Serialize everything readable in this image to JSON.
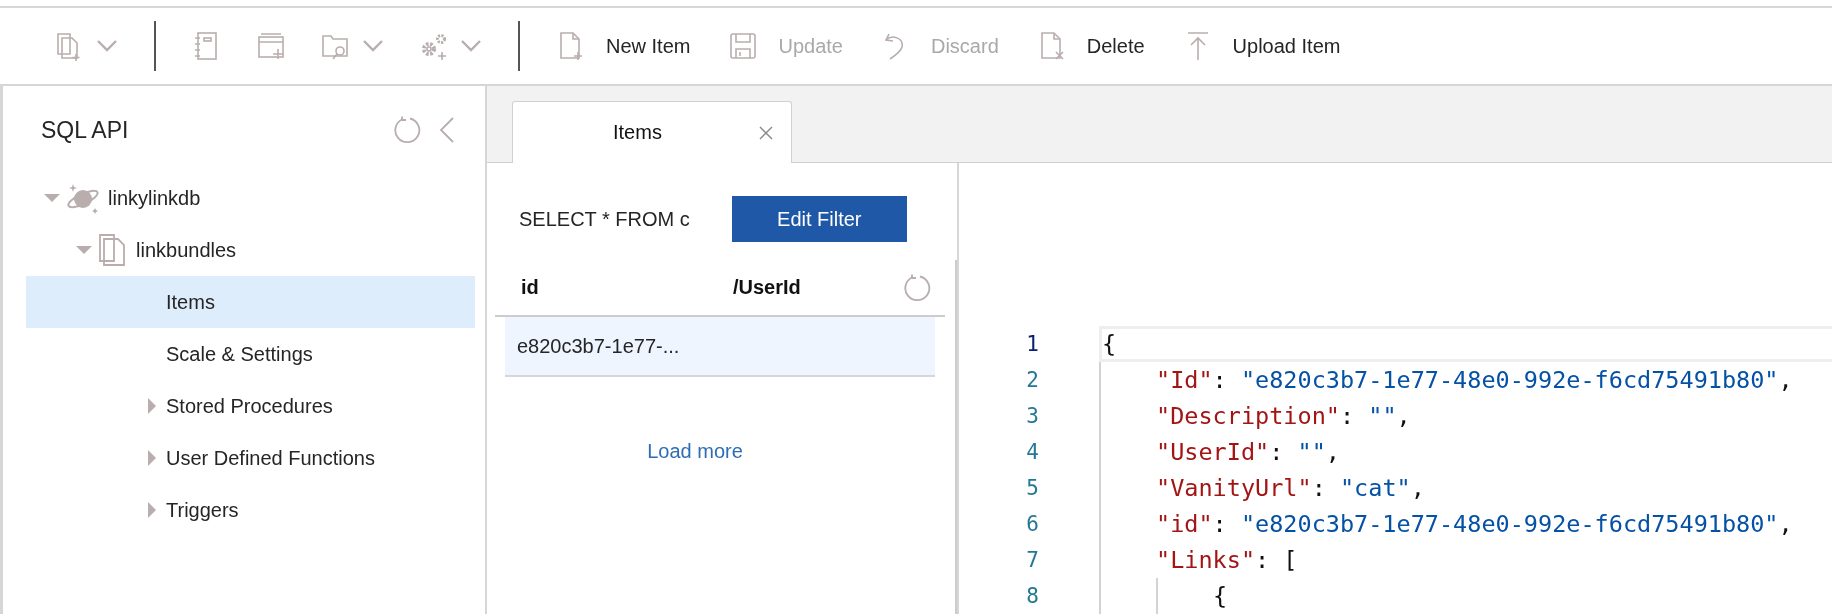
{
  "toolbar": [
    {
      "kind": "icon",
      "dropdown": true
    },
    {
      "kind": "separator"
    },
    {
      "kind": "icon",
      "dropdown": false
    },
    {
      "kind": "icon",
      "dropdown": false
    },
    {
      "kind": "icon",
      "dropdown": true
    },
    {
      "kind": "icon",
      "dropdown": true
    },
    {
      "kind": "separator"
    },
    {
      "kind": "labeled",
      "label": "New Item",
      "disabled": false
    },
    {
      "kind": "labeled",
      "label": "Update",
      "disabled": true
    },
    {
      "kind": "labeled",
      "label": "Discard",
      "disabled": true
    },
    {
      "kind": "labeled",
      "label": "Delete",
      "disabled": false
    },
    {
      "kind": "labeled",
      "label": "Upload Item",
      "disabled": false
    }
  ],
  "sidebar": {
    "title": "SQL API",
    "tree": [
      {
        "label": "linkylinkdb",
        "kind": "database",
        "expanded": true,
        "selected": false,
        "children": [
          {
            "label": "linkbundles",
            "kind": "container",
            "expanded": true,
            "selected": false,
            "children": [
              {
                "label": "Items",
                "kind": "leaf",
                "selected": true
              },
              {
                "label": "Scale & Settings",
                "kind": "leaf",
                "selected": false
              },
              {
                "label": "Stored Procedures",
                "kind": "folder",
                "expanded": false,
                "selected": false
              },
              {
                "label": "User Defined Functions",
                "kind": "folder",
                "expanded": false,
                "selected": false
              },
              {
                "label": "Triggers",
                "kind": "folder",
                "expanded": false,
                "selected": false
              }
            ]
          }
        ]
      }
    ]
  },
  "tabs": [
    {
      "label": "Items",
      "selected": true
    }
  ],
  "query": {
    "text": "SELECT * FROM c",
    "button": "Edit Filter"
  },
  "table": {
    "columns": [
      "id",
      "/UserId"
    ],
    "rows": [
      {
        "cells": [
          "e820c3b7-1e77-..."
        ],
        "selected": true
      }
    ],
    "load_more": "Load more"
  },
  "editor": {
    "lines": [
      {
        "number": "1",
        "current": true,
        "tokens": [
          {
            "kind": "punct",
            "text": "{"
          }
        ],
        "children": [
          {
            "number": "2",
            "current": false,
            "tokens": [
              {
                "kind": "key",
                "text": "\"Id\""
              },
              {
                "kind": "punct",
                "text": ": "
              },
              {
                "kind": "string",
                "text": "\"e820c3b7-1e77-48e0-992e-f6cd75491b80\""
              },
              {
                "kind": "punct",
                "text": ","
              }
            ]
          },
          {
            "number": "3",
            "current": false,
            "tokens": [
              {
                "kind": "key",
                "text": "\"Description\""
              },
              {
                "kind": "punct",
                "text": ": "
              },
              {
                "kind": "string",
                "text": "\"\""
              },
              {
                "kind": "punct",
                "text": ","
              }
            ]
          },
          {
            "number": "4",
            "current": false,
            "tokens": [
              {
                "kind": "key",
                "text": "\"UserId\""
              },
              {
                "kind": "punct",
                "text": ": "
              },
              {
                "kind": "string",
                "text": "\"\""
              },
              {
                "kind": "punct",
                "text": ","
              }
            ]
          },
          {
            "number": "5",
            "current": false,
            "tokens": [
              {
                "kind": "key",
                "text": "\"VanityUrl\""
              },
              {
                "kind": "punct",
                "text": ": "
              },
              {
                "kind": "string",
                "text": "\"cat\""
              },
              {
                "kind": "punct",
                "text": ","
              }
            ]
          },
          {
            "number": "6",
            "current": false,
            "tokens": [
              {
                "kind": "key",
                "text": "\"id\""
              },
              {
                "kind": "punct",
                "text": ": "
              },
              {
                "kind": "string",
                "text": "\"e820c3b7-1e77-48e0-992e-f6cd75491b80\""
              },
              {
                "kind": "punct",
                "text": ","
              }
            ]
          },
          {
            "number": "7",
            "current": false,
            "tokens": [
              {
                "kind": "key",
                "text": "\"Links\""
              },
              {
                "kind": "punct",
                "text": ": ["
              }
            ],
            "children": [
              {
                "number": "8",
                "current": false,
                "tokens": [
                  {
                    "kind": "punct",
                    "text": "{"
                  }
                ]
              }
            ]
          }
        ]
      }
    ]
  }
}
